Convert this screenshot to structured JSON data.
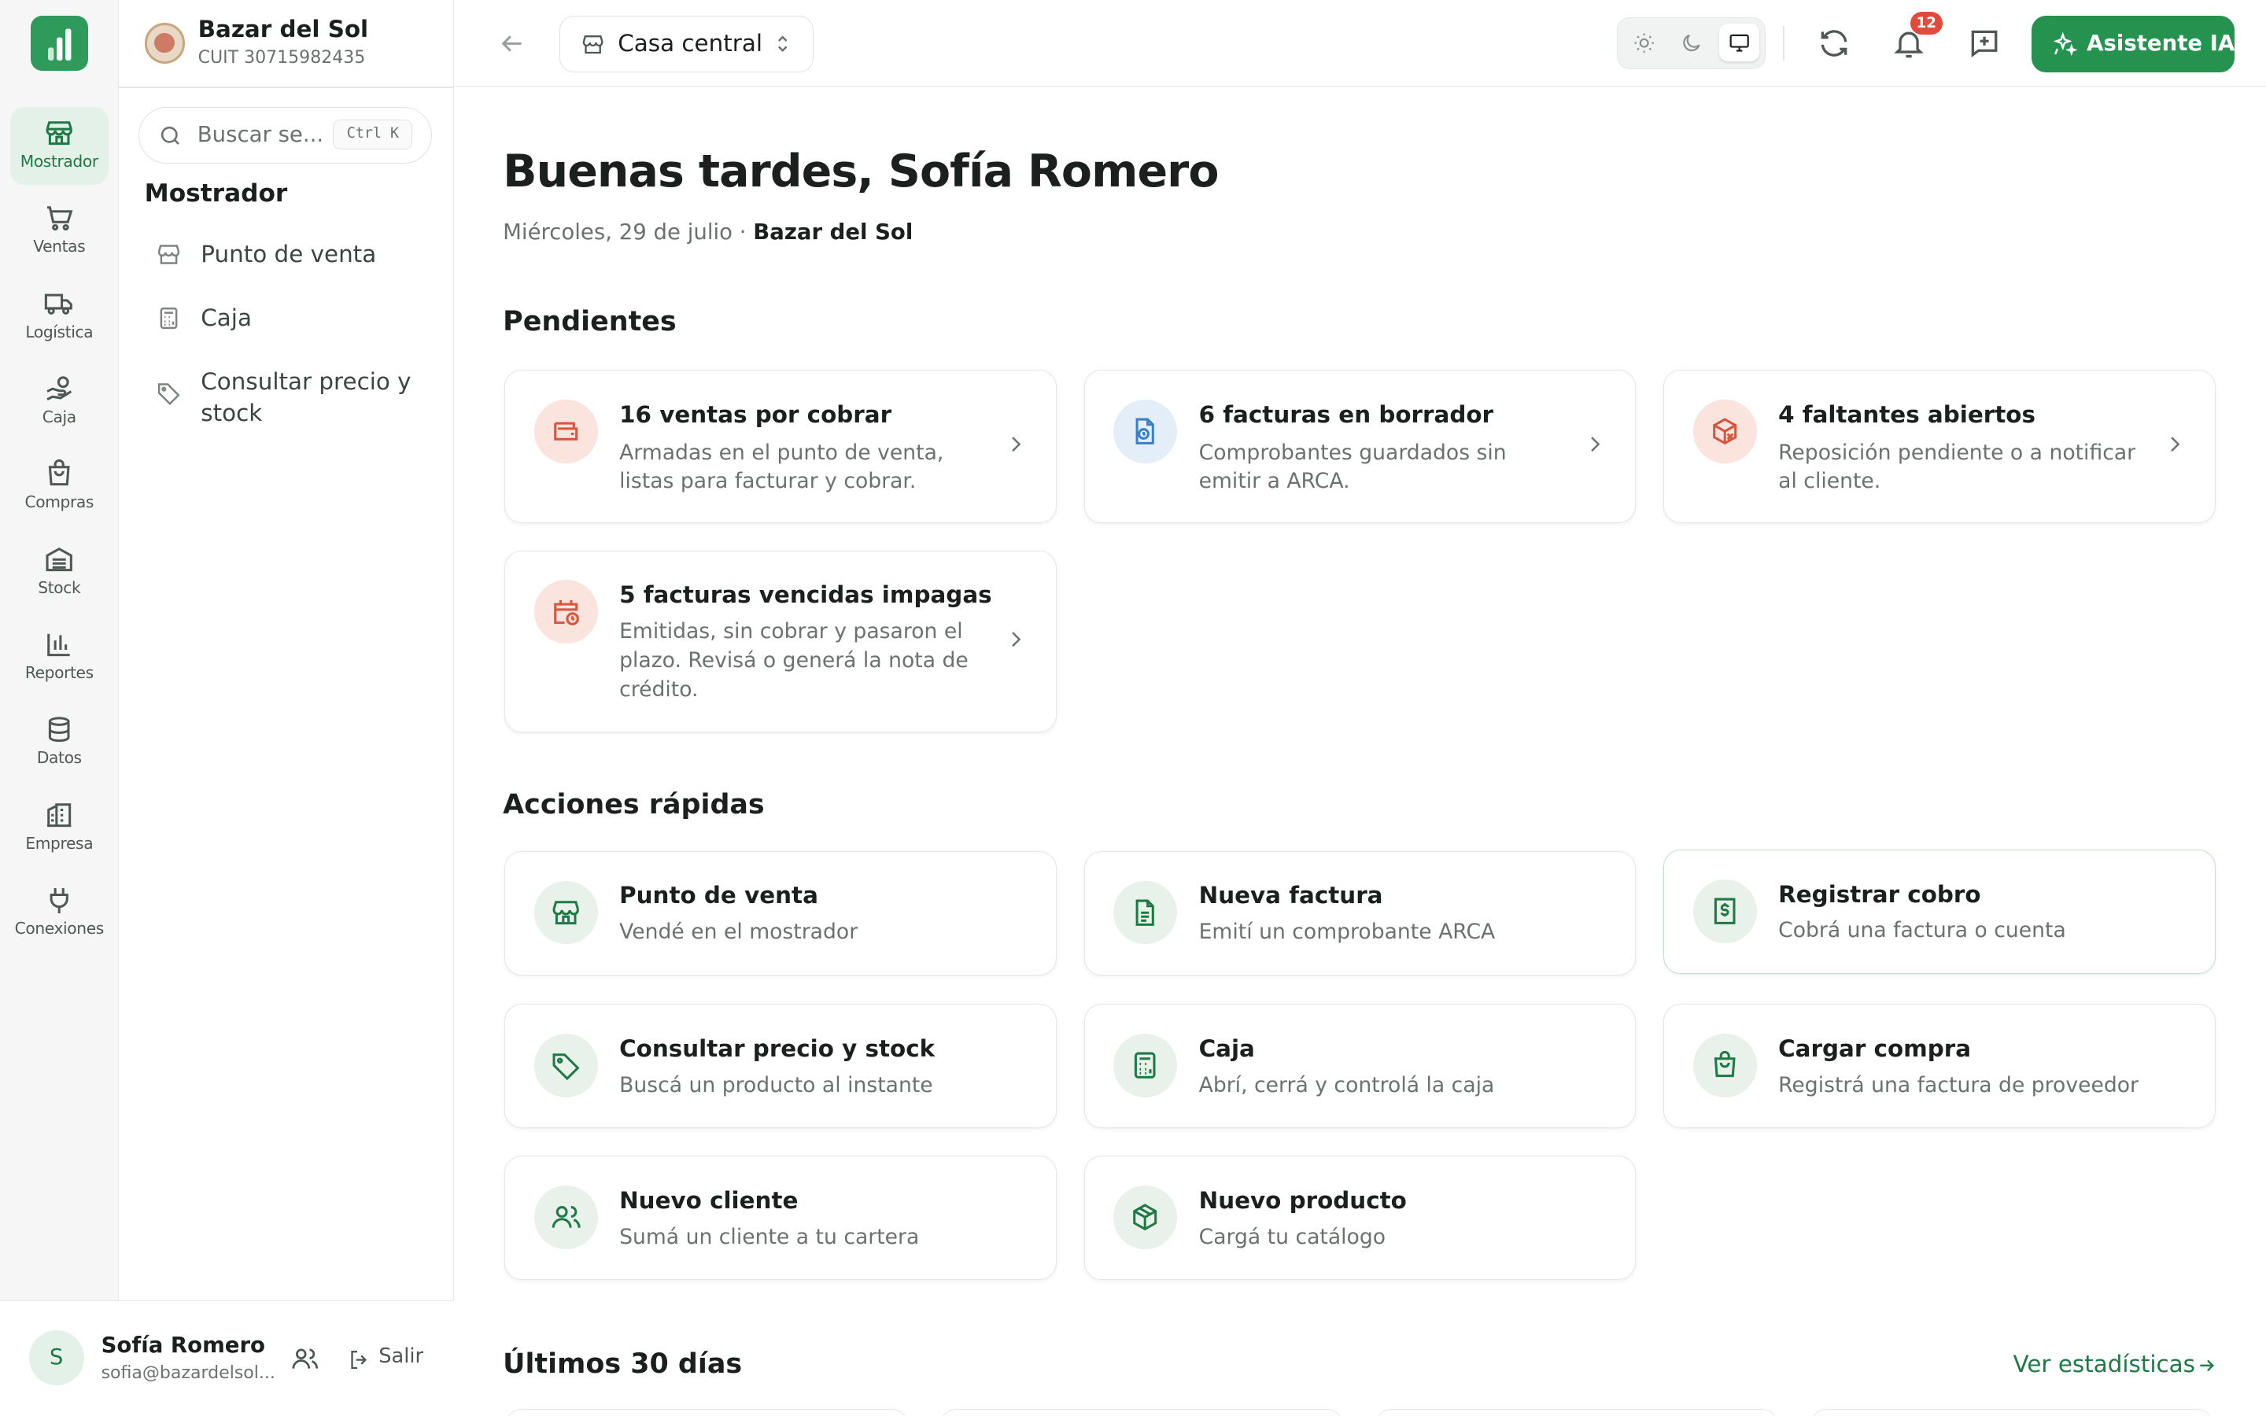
{
  "rail": {
    "items": [
      {
        "label": "Mostrador",
        "icon": "store-icon",
        "active": true
      },
      {
        "label": "Ventas",
        "icon": "cart-icon"
      },
      {
        "label": "Logística",
        "icon": "truck-icon"
      },
      {
        "label": "Caja",
        "icon": "hand-coins-icon"
      },
      {
        "label": "Compras",
        "icon": "shopping-bag-icon"
      },
      {
        "label": "Stock",
        "icon": "warehouse-icon"
      },
      {
        "label": "Reportes",
        "icon": "bar-chart-icon"
      },
      {
        "label": "Datos",
        "icon": "database-icon"
      },
      {
        "label": "Empresa",
        "icon": "building-icon"
      },
      {
        "label": "Conexiones",
        "icon": "plug-icon"
      }
    ]
  },
  "org": {
    "name": "Bazar del Sol",
    "cuit": "CUIT 30715982435"
  },
  "search": {
    "placeholder": "Buscar se...",
    "shortcut": "Ctrl K"
  },
  "submenu": {
    "title": "Mostrador",
    "items": [
      {
        "label": "Punto de venta",
        "icon": "store-icon"
      },
      {
        "label": "Caja",
        "icon": "calculator-icon"
      },
      {
        "label": "Consultar precio y stock",
        "icon": "tag-icon"
      }
    ]
  },
  "user": {
    "initial": "S",
    "name": "Sofía Romero",
    "email": "sofia@bazardelsol...",
    "logout": "Salir"
  },
  "topbar": {
    "branch": "Casa central",
    "notifications": "12",
    "ai_label": "Asistente IA"
  },
  "greeting": {
    "title": "Buenas tardes, Sofía Romero",
    "date": "Miércoles, 29 de julio · ",
    "store": "Bazar del Sol"
  },
  "pending": {
    "title": "Pendientes",
    "cards": [
      {
        "title": "16 ventas por cobrar",
        "desc": "Armadas en el punto de venta, listas para facturar y cobrar.",
        "icon": "wallet-icon"
      },
      {
        "title": "6 facturas en borrador",
        "desc": "Comprobantes guardados sin emitir a ARCA.",
        "icon": "file-clock-icon"
      },
      {
        "title": "4 faltantes abiertos",
        "desc": "Reposición pendiente o a notificar al cliente.",
        "icon": "package-x-icon"
      },
      {
        "title": "5 facturas vencidas impagas",
        "desc": "Emitidas, sin cobrar y pasaron el plazo. Revisá o generá la nota de crédito.",
        "icon": "calendar-clock-icon"
      }
    ]
  },
  "quick": {
    "title": "Acciones rápidas",
    "cards": [
      {
        "title": "Punto de venta",
        "desc": "Vendé en el mostrador",
        "icon": "store-icon"
      },
      {
        "title": "Nueva factura",
        "desc": "Emití un comprobante ARCA",
        "icon": "file-text-icon"
      },
      {
        "title": "Registrar cobro",
        "desc": "Cobrá una factura o cuenta",
        "icon": "receipt-dollar-icon"
      },
      {
        "title": "Consultar precio y stock",
        "desc": "Buscá un producto al instante",
        "icon": "tag-icon"
      },
      {
        "title": "Caja",
        "desc": "Abrí, cerrá y controlá la caja",
        "icon": "calculator-icon"
      },
      {
        "title": "Cargar compra",
        "desc": "Registrá una factura de proveedor",
        "icon": "shopping-bag-icon"
      },
      {
        "title": "Nuevo cliente",
        "desc": "Sumá un cliente a tu cartera",
        "icon": "users-icon"
      },
      {
        "title": "Nuevo producto",
        "desc": "Cargá tu catálogo",
        "icon": "box-icon"
      }
    ]
  },
  "last30": {
    "title": "Últimos 30 días",
    "link": "Ver estadísticas"
  },
  "colors": {
    "brand": "#25924f",
    "alert": "#e14b3b",
    "info": "#3b7fc4"
  }
}
